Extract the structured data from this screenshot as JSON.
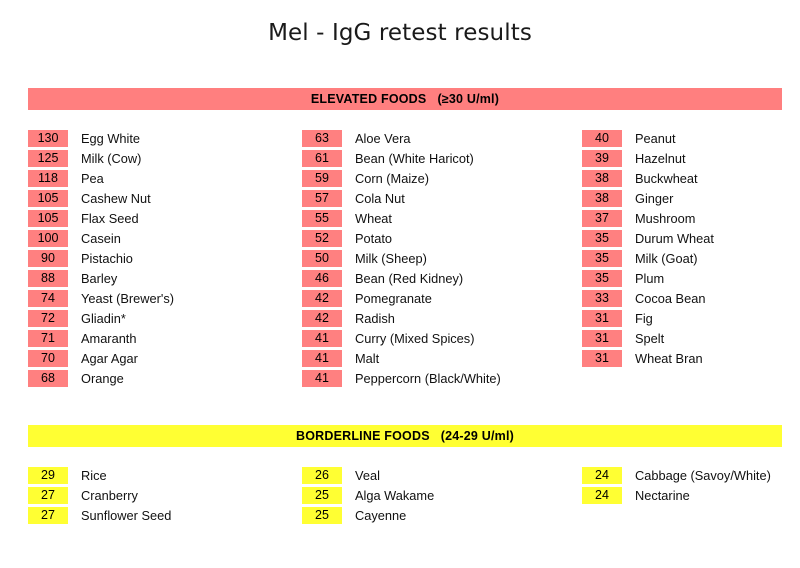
{
  "title": "Mel - IgG retest results",
  "colors": {
    "elevated_bar": "#ff7f7f",
    "elevated_badge": "#ff8080",
    "borderline_bar": "#ffff33",
    "borderline_badge": "#ffff33",
    "text": "#111111",
    "background": "#ffffff"
  },
  "sections": [
    {
      "id": "elevated",
      "header": "ELEVATED FOODS   (≥30 U/ml)",
      "columns": [
        [
          {
            "value": "130",
            "food": "Egg White"
          },
          {
            "value": "125",
            "food": "Milk (Cow)"
          },
          {
            "value": "118",
            "food": "Pea"
          },
          {
            "value": "105",
            "food": "Cashew Nut"
          },
          {
            "value": "105",
            "food": "Flax Seed"
          },
          {
            "value": "100",
            "food": "Casein"
          },
          {
            "value": "90",
            "food": "Pistachio"
          },
          {
            "value": "88",
            "food": "Barley"
          },
          {
            "value": "74",
            "food": "Yeast (Brewer's)"
          },
          {
            "value": "72",
            "food": "Gliadin*"
          },
          {
            "value": "71",
            "food": "Amaranth"
          },
          {
            "value": "70",
            "food": "Agar Agar"
          },
          {
            "value": "68",
            "food": "Orange"
          }
        ],
        [
          {
            "value": "63",
            "food": "Aloe Vera"
          },
          {
            "value": "61",
            "food": "Bean (White Haricot)"
          },
          {
            "value": "59",
            "food": "Corn (Maize)"
          },
          {
            "value": "57",
            "food": "Cola Nut"
          },
          {
            "value": "55",
            "food": "Wheat"
          },
          {
            "value": "52",
            "food": "Potato"
          },
          {
            "value": "50",
            "food": "Milk (Sheep)"
          },
          {
            "value": "46",
            "food": "Bean (Red Kidney)"
          },
          {
            "value": "42",
            "food": "Pomegranate"
          },
          {
            "value": "42",
            "food": "Radish"
          },
          {
            "value": "41",
            "food": "Curry (Mixed Spices)"
          },
          {
            "value": "41",
            "food": "Malt"
          },
          {
            "value": "41",
            "food": "Peppercorn (Black/White)"
          }
        ],
        [
          {
            "value": "40",
            "food": "Peanut"
          },
          {
            "value": "39",
            "food": "Hazelnut"
          },
          {
            "value": "38",
            "food": "Buckwheat"
          },
          {
            "value": "38",
            "food": "Ginger"
          },
          {
            "value": "37",
            "food": "Mushroom"
          },
          {
            "value": "35",
            "food": "Durum Wheat"
          },
          {
            "value": "35",
            "food": "Milk (Goat)"
          },
          {
            "value": "35",
            "food": "Plum"
          },
          {
            "value": "33",
            "food": "Cocoa Bean"
          },
          {
            "value": "31",
            "food": "Fig"
          },
          {
            "value": "31",
            "food": "Spelt"
          },
          {
            "value": "31",
            "food": "Wheat Bran"
          }
        ]
      ]
    },
    {
      "id": "borderline",
      "header": "BORDERLINE FOODS   (24-29 U/ml)",
      "columns": [
        [
          {
            "value": "29",
            "food": "Rice"
          },
          {
            "value": "27",
            "food": "Cranberry"
          },
          {
            "value": "27",
            "food": "Sunflower Seed"
          }
        ],
        [
          {
            "value": "26",
            "food": "Veal"
          },
          {
            "value": "25",
            "food": "Alga Wakame"
          },
          {
            "value": "25",
            "food": "Cayenne"
          }
        ],
        [
          {
            "value": "24",
            "food": "Cabbage (Savoy/White)"
          },
          {
            "value": "24",
            "food": "Nectarine"
          }
        ]
      ]
    }
  ]
}
